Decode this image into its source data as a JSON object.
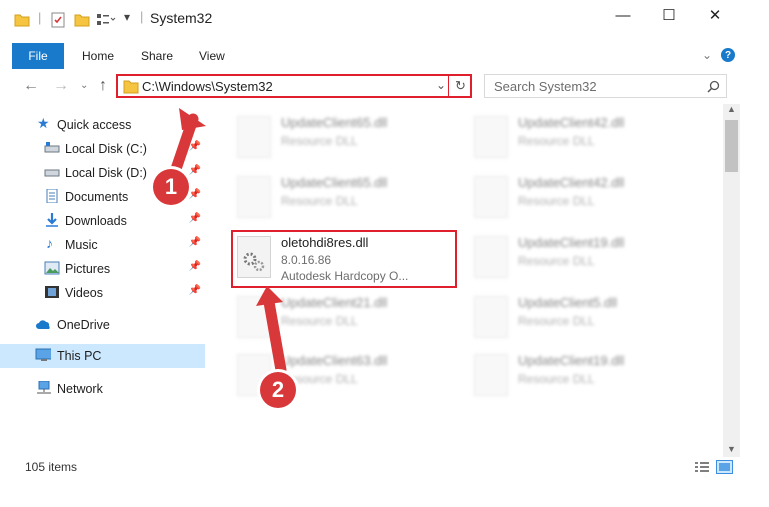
{
  "window": {
    "title": "System32",
    "controls": {
      "minimize": "—",
      "maximize": "☐",
      "close": "✕"
    }
  },
  "ribbon": {
    "tabs": [
      "File",
      "Home",
      "Share",
      "View"
    ]
  },
  "address": {
    "path": "C:\\Windows\\System32"
  },
  "search": {
    "placeholder": "Search System32"
  },
  "sidebar": {
    "items": [
      {
        "label": "Quick access",
        "icon": "star-icon"
      },
      {
        "label": "Local Disk (C:)",
        "icon": "drive-icon",
        "pinned": true
      },
      {
        "label": "Local Disk (D:)",
        "icon": "drive-icon",
        "pinned": true
      },
      {
        "label": "Documents",
        "icon": "documents-icon",
        "pinned": true
      },
      {
        "label": "Downloads",
        "icon": "downloads-icon",
        "pinned": true
      },
      {
        "label": "Music",
        "icon": "music-icon",
        "pinned": true
      },
      {
        "label": "Pictures",
        "icon": "pictures-icon",
        "pinned": true
      },
      {
        "label": "Videos",
        "icon": "videos-icon",
        "pinned": true
      },
      {
        "label": "OneDrive",
        "icon": "cloud-icon"
      },
      {
        "label": "This PC",
        "icon": "computer-icon",
        "selected": true
      },
      {
        "label": "Network",
        "icon": "network-icon"
      }
    ]
  },
  "files": {
    "col1": [
      {
        "name": "UpdateClient65.dll",
        "sub": "Resource DLL"
      },
      {
        "name": "UpdateClient65.dll",
        "sub": "Resource DLL"
      },
      {
        "name": "oletohdi8res.dll",
        "sub": "8.0.16.86",
        "sub2": "Autodesk Hardcopy O..."
      },
      {
        "name": "UpdateClient21.dll",
        "sub": "Resource DLL"
      },
      {
        "name": "UpdateClient63.dll",
        "sub": "Resource DLL"
      }
    ],
    "col2": [
      {
        "name": "UpdateClient42.dll",
        "sub": "Resource DLL"
      },
      {
        "name": "UpdateClient42.dll",
        "sub": "Resource DLL"
      },
      {
        "name": "UpdateClient19.dll",
        "sub": "Resource DLL"
      },
      {
        "name": "UpdateClient5.dll",
        "sub": "Resource DLL"
      },
      {
        "name": "UpdateClient19.dll",
        "sub": "Resource DLL"
      }
    ]
  },
  "status": {
    "items": "105 items"
  },
  "annotations": {
    "badge1": "1",
    "badge2": "2"
  },
  "colors": {
    "accent": "#1979ca",
    "annotation": "#e01f2c",
    "badge": "#d9383a"
  }
}
